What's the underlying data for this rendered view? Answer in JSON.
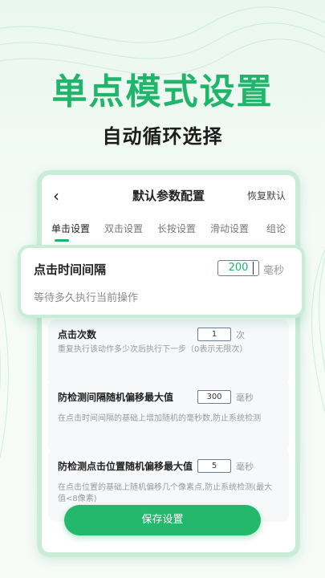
{
  "hero": {
    "title": "单点模式设置",
    "subtitle": "自动循环选择"
  },
  "topbar": {
    "back_icon": "‹",
    "title": "默认参数配置",
    "restore_label": "恢复默认"
  },
  "tabs": [
    {
      "label": "单击设置",
      "active": true
    },
    {
      "label": "双击设置",
      "active": false
    },
    {
      "label": "长按设置",
      "active": false
    },
    {
      "label": "滑动设置",
      "active": false
    },
    {
      "label": "组论",
      "active": false
    }
  ],
  "highlight": {
    "title": "点击时间间隔",
    "value": "200",
    "unit": "毫秒",
    "desc": "等待多久执行当前操作"
  },
  "cards": [
    {
      "title": "点击次数",
      "value": "1",
      "unit": "次",
      "desc": "重复执行该动作多少次后执行下一步（0表示无限次）"
    },
    {
      "title": "防检测间隔随机偏移最大值",
      "value": "300",
      "unit": "毫秒",
      "desc": "在点击时间间隔的基础上增加随机的毫秒数,防止系统检测"
    },
    {
      "title": "防检测点击位置随机偏移最大值",
      "value": "5",
      "unit": "毫秒",
      "desc": "在点击位置的基础上随机偏移几个像素点,防止系统检测(最大值<8像素)"
    }
  ],
  "save_label": "保存设置",
  "colors": {
    "accent": "#20b56b",
    "button": "#23b86c",
    "frame": "#c9ecd8"
  }
}
